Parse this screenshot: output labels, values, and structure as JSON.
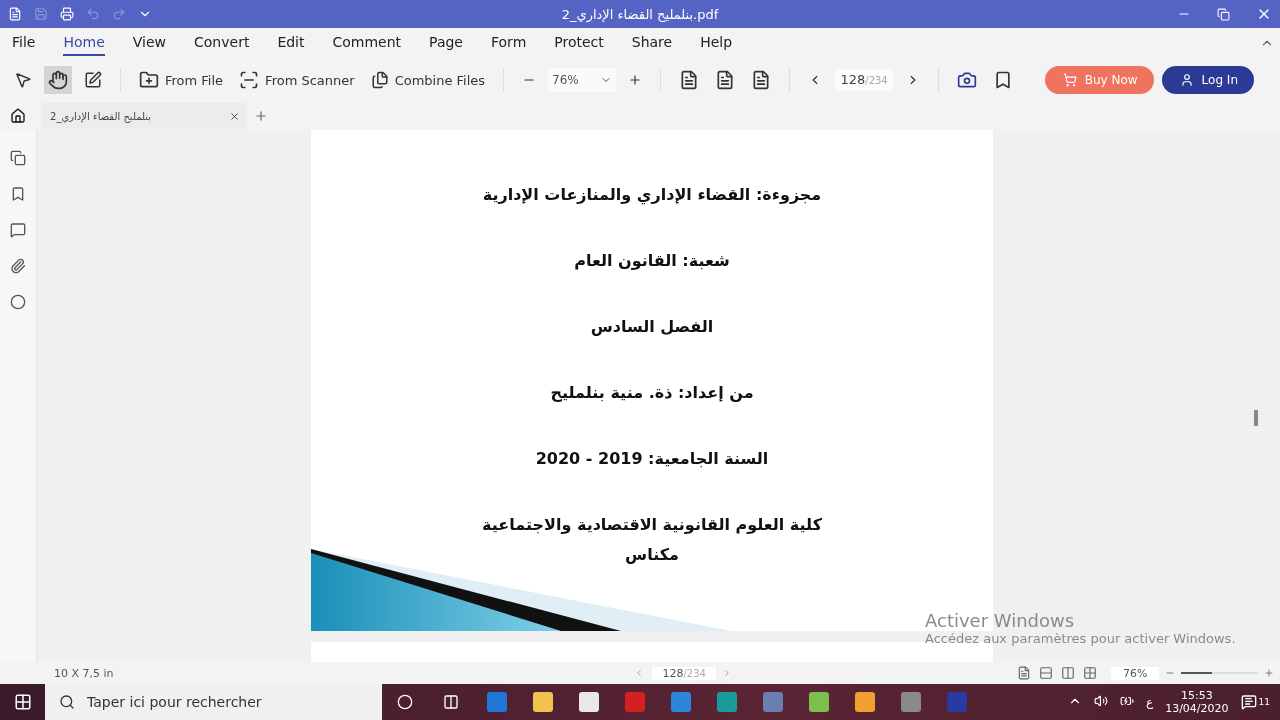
{
  "window": {
    "title": "بنلمليح القضاء الإداري_2.pdf"
  },
  "menu": [
    {
      "label": "File",
      "selected": false
    },
    {
      "label": "Home",
      "selected": true
    },
    {
      "label": "View",
      "selected": false
    },
    {
      "label": "Convert",
      "selected": false
    },
    {
      "label": "Edit",
      "selected": false
    },
    {
      "label": "Comment",
      "selected": false
    },
    {
      "label": "Page",
      "selected": false
    },
    {
      "label": "Form",
      "selected": false
    },
    {
      "label": "Protect",
      "selected": false
    },
    {
      "label": "Share",
      "selected": false
    },
    {
      "label": "Help",
      "selected": false
    }
  ],
  "toolbar": {
    "hand_selected": true,
    "from_file": "From File",
    "from_scanner": "From Scanner",
    "combine": "Combine Files",
    "zoom": "76%",
    "page": "128",
    "page_total": "/234",
    "buy": "Buy Now",
    "login": "Log In"
  },
  "doc_tab": {
    "label": "بنلمليح القضاء الإداري_2"
  },
  "page_lines": [
    {
      "text": "مجزوءة: القضاء الإداري والمنازعات الإدارية"
    },
    {
      "text": "شعبة: القانون العام"
    },
    {
      "text": "الفصل السادس"
    },
    {
      "text": "من إعداد: ذة. منية بنلمليح"
    },
    {
      "text": "السنة الجامعية: 2019 - 2020"
    },
    {
      "text": "كلية العلوم القانونية الاقتصادية والاجتماعية"
    },
    {
      "text": "مكناس"
    }
  ],
  "activation": {
    "title": "Activer Windows",
    "subtitle": "Accédez aux paramètres pour activer Windows."
  },
  "status_bar": {
    "size": "10 X 7,5 in",
    "page": "128",
    "page_total": "/234",
    "zoom": "76%",
    "level": 0.4
  },
  "taskbar": {
    "search_placeholder": "Taper ici pour rechercher",
    "lang": "ع",
    "time": "15:53",
    "date": "13/04/2020",
    "notifications": "11"
  }
}
